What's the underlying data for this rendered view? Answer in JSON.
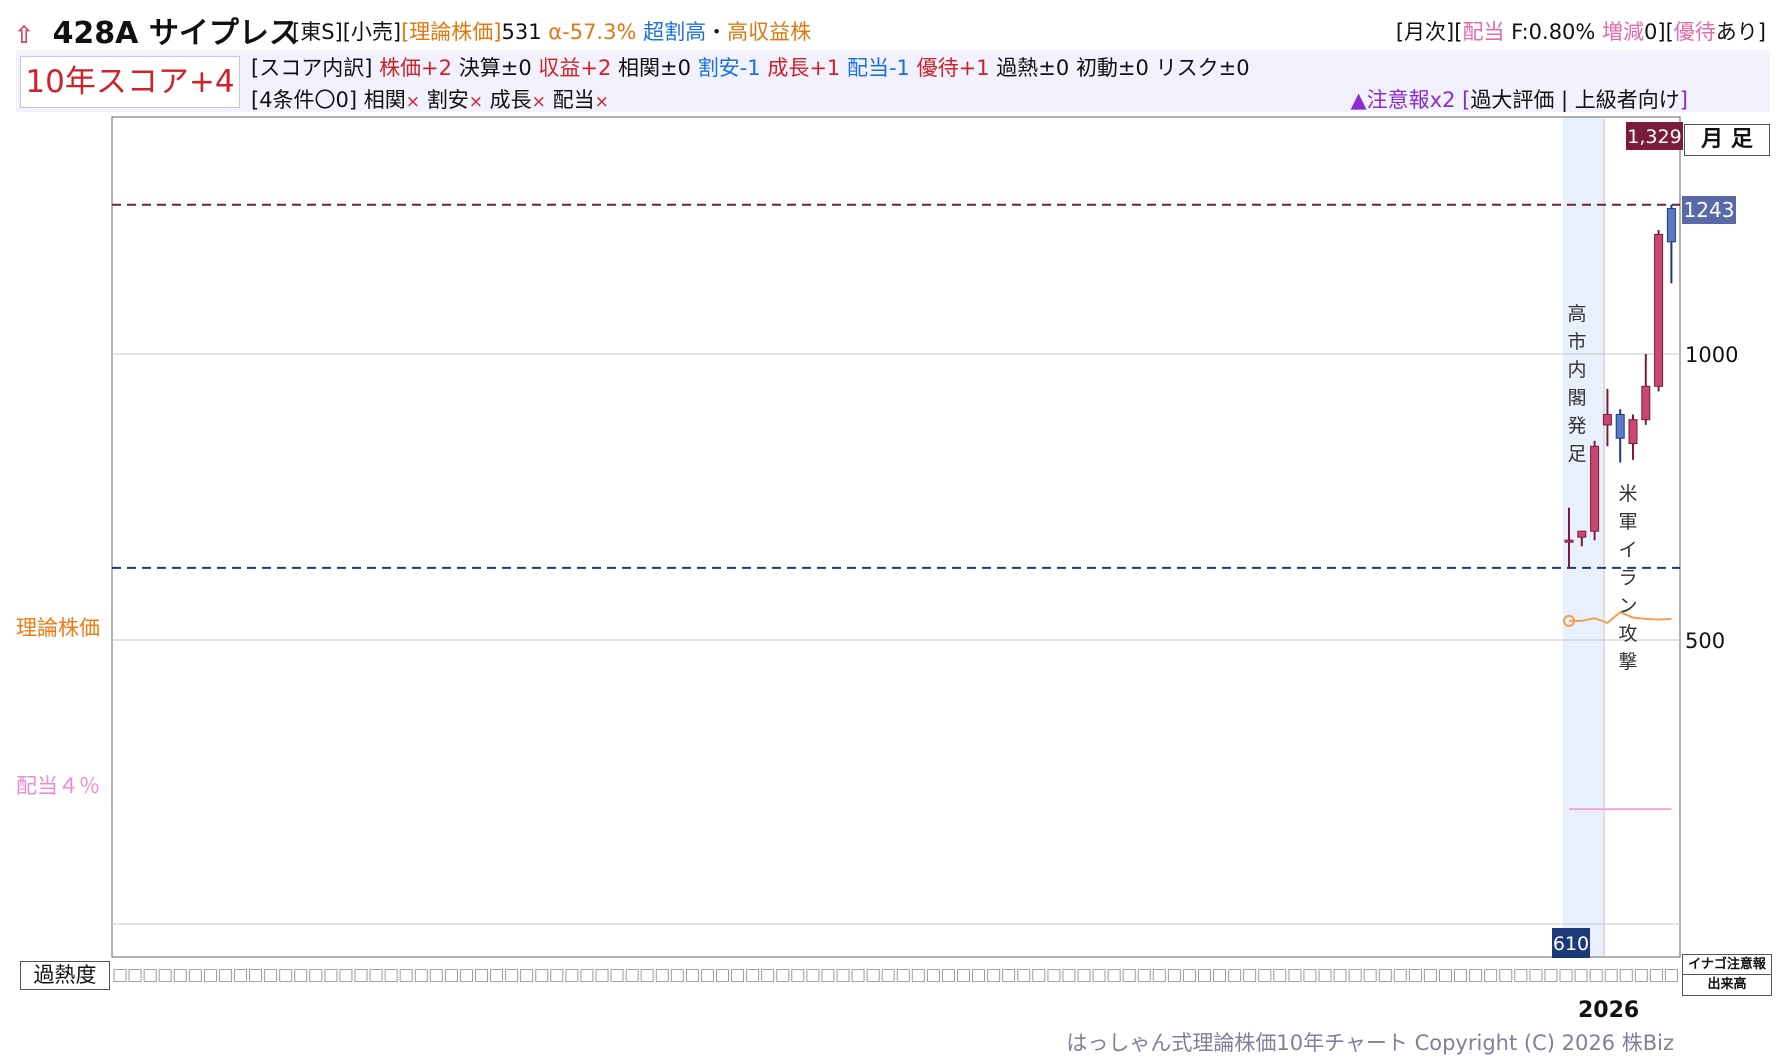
{
  "header": {
    "up_arrow": "⇧",
    "code_name": "428A サイプレス",
    "tag_market": "[東S][小売]",
    "tag_theory": "[理論株価]",
    "theory_value": "531",
    "alpha": "α-57.3%",
    "tag_cheap": "超割高",
    "tag_dot": "・",
    "tag_yield": "高収益株",
    "right_open": "[月次][",
    "right_div": "配当",
    "right_f": " F:0.80% ",
    "right_change": "増減",
    "right_change_val": "0][",
    "right_perk": "優待",
    "right_perk_val": "あり]"
  },
  "score": {
    "label": "10年スコア+4"
  },
  "breakdown": {
    "prefix": "[スコア内訳] ",
    "items": [
      {
        "text": "株価+2",
        "color": "red"
      },
      {
        "text": "決算±0",
        "color": "black"
      },
      {
        "text": "収益+2",
        "color": "red"
      },
      {
        "text": "相関±0",
        "color": "black"
      },
      {
        "text": "割安-1",
        "color": "blue"
      },
      {
        "text": "成長+1",
        "color": "red"
      },
      {
        "text": "配当-1",
        "color": "blue"
      },
      {
        "text": "優待+1",
        "color": "red"
      },
      {
        "text": "過熱±0",
        "color": "black"
      },
      {
        "text": "初動±0",
        "color": "black"
      },
      {
        "text": "リスク±0",
        "color": "black"
      }
    ]
  },
  "conditions": {
    "prefix": "[4条件〇0] ",
    "items": [
      {
        "label": "相関",
        "mark": "×"
      },
      {
        "label": "割安",
        "mark": "×"
      },
      {
        "label": "成長",
        "mark": "×"
      },
      {
        "label": "配当",
        "mark": "×"
      }
    ]
  },
  "warning": {
    "mark": "▲注意報x2 ",
    "bracket_open": "[",
    "text": "過大評価 | 上級者向け",
    "bracket_close": "]"
  },
  "side_labels": {
    "theory": "理論株価",
    "dividend": "配当４％"
  },
  "month_box": "月 足",
  "heat_label": "過熱度",
  "heat_cells": "□□□□□□□□□□□□□□□□□□□□□□□□□□□□□□□□□□□□□□□□□□□□□□□□□□□□□□□□□□□□□□□□□□□□□□□□□□□□□□□□□□□□□□□□□□□□□□□□□□□□□□□□□□□□□□□□□□",
  "inago_box": "イナゴ注意報",
  "volume_box": "出来高",
  "year_label": "2026",
  "copyright": "はっしゃん式理論株価10年チャート Copyright (C) 2026 株Biz",
  "chart_data": {
    "type": "candlestick",
    "timeframe": "月足",
    "y_scale": "sqrt",
    "y_ticks": [
      500,
      1000
    ],
    "y_tick_labels": [
      "500",
      "1000"
    ],
    "high_marker": {
      "value": 1329,
      "label": "1,329",
      "color": "#7a1c3c"
    },
    "low_marker": {
      "value": 610,
      "label": "610",
      "color": "#1c3a78"
    },
    "last_price": {
      "value": 1243,
      "label": "1243",
      "color": "#5a6aa8"
    },
    "theory_line": [
      {
        "i": 0,
        "v": 528
      },
      {
        "i": 1,
        "v": 528
      },
      {
        "i": 2,
        "v": 532
      },
      {
        "i": 3,
        "v": 525
      },
      {
        "i": 4,
        "v": 541
      },
      {
        "i": 5,
        "v": 533
      },
      {
        "i": 6,
        "v": 531
      },
      {
        "i": 7,
        "v": 530
      },
      {
        "i": 8,
        "v": 531
      }
    ],
    "dividend_line_value": 285,
    "candles": [
      {
        "i": 0,
        "open": 655,
        "high": 710,
        "low": 610,
        "close": 655
      },
      {
        "i": 1,
        "open": 660,
        "high": 670,
        "low": 645,
        "close": 670
      },
      {
        "i": 2,
        "open": 670,
        "high": 830,
        "low": 655,
        "close": 820
      },
      {
        "i": 3,
        "open": 860,
        "high": 930,
        "low": 820,
        "close": 880
      },
      {
        "i": 4,
        "open": 880,
        "high": 890,
        "low": 790,
        "close": 835
      },
      {
        "i": 5,
        "open": 825,
        "high": 880,
        "low": 795,
        "close": 870
      },
      {
        "i": 6,
        "open": 870,
        "high": 1000,
        "low": 860,
        "close": 935
      },
      {
        "i": 7,
        "open": 935,
        "high": 1270,
        "low": 925,
        "close": 1260
      },
      {
        "i": 8,
        "open": 1320,
        "high": 1329,
        "low": 1150,
        "close": 1243
      }
    ],
    "events": [
      {
        "label": "高市内閣発足",
        "at_index": 0
      },
      {
        "label": "米軍イラン攻撃",
        "at_index": 4
      }
    ],
    "x_year_label": "2026",
    "colors": {
      "up": "#c84870",
      "down": "#5a7ac8"
    }
  }
}
